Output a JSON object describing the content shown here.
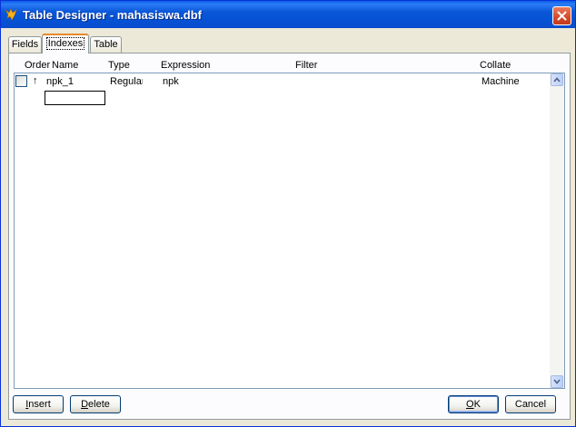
{
  "window": {
    "title": "Table Designer - mahasiswa.dbf"
  },
  "tabs": [
    {
      "label": "Fields",
      "active": false
    },
    {
      "label": "Indexes",
      "active": true
    },
    {
      "label": "Table",
      "active": false
    }
  ],
  "columns": {
    "order": "Order",
    "name": "Name",
    "type": "Type",
    "expression": "Expression",
    "filter": "Filter",
    "collate": "Collate"
  },
  "rows": [
    {
      "order_symbol": "↑",
      "name": "npk_1",
      "type": "Regular",
      "expression": "npk",
      "filter": "",
      "collate": "Machine"
    }
  ],
  "new_index": {
    "name_value": ""
  },
  "buttons": {
    "insert": {
      "prefix": "",
      "accel": "I",
      "suffix": "nsert"
    },
    "delete": {
      "prefix": "",
      "accel": "D",
      "suffix": "elete"
    },
    "ok": {
      "prefix": "",
      "accel": "O",
      "suffix": "K"
    },
    "cancel": "Cancel"
  },
  "colors": {
    "title_bar": "#0a57d8",
    "active_tab_accent": "#e68b2c",
    "close_button": "#d6492a"
  }
}
